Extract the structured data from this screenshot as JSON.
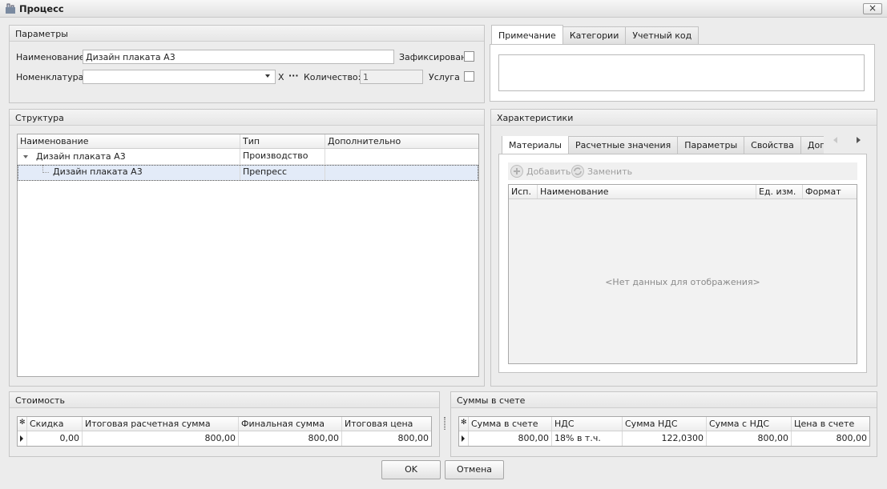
{
  "window": {
    "title": "Процесс",
    "close": "×"
  },
  "params": {
    "header": "Параметры",
    "name_label": "Наименование:",
    "name_value": "Дизайн плаката А3",
    "fixed_label": "Зафиксирован",
    "nomen_label": "Номенклатура:",
    "nomen_value": "",
    "clear_glyph": "X",
    "dots_glyph": "···",
    "qty_label": "Количество:",
    "qty_value": "1",
    "service_label": "Услуга"
  },
  "note_tabs": [
    "Примечание",
    "Категории",
    "Учетный код"
  ],
  "structure": {
    "header": "Структура",
    "columns": [
      "Наименование",
      "Тип",
      "Дополнительно"
    ],
    "rows": [
      {
        "name": "Дизайн плаката А3",
        "type": "Производство",
        "extra": ""
      },
      {
        "name": "Дизайн плаката А3",
        "type": "Препресс",
        "extra": ""
      }
    ]
  },
  "chars": {
    "header": "Характеристики",
    "tabs": [
      "Материалы",
      "Расчетные значения",
      "Параметры",
      "Свойства",
      "Дополнен"
    ],
    "add_label": "Добавить",
    "replace_label": "Заменить",
    "columns": [
      "Исп.",
      "Наименование",
      "Ед. изм.",
      "Формат"
    ],
    "empty_text": "<Нет данных для отображения>"
  },
  "cost": {
    "header": "Стоимость",
    "columns": [
      "Скидка",
      "Итоговая расчетная сумма",
      "Финальная сумма",
      "Итоговая цена"
    ],
    "row": [
      "0,00",
      "800,00",
      "800,00",
      "800,00"
    ]
  },
  "invoice": {
    "header": "Суммы в счете",
    "columns": [
      "Сумма в счете",
      "НДС",
      "Сумма НДС",
      "Сумма с НДС",
      "Цена в счете"
    ],
    "row": [
      "800,00",
      "18% в т.ч.",
      "122,0300",
      "800,00",
      "800,00"
    ]
  },
  "buttons": {
    "ok": "OK",
    "cancel": "Отмена"
  }
}
